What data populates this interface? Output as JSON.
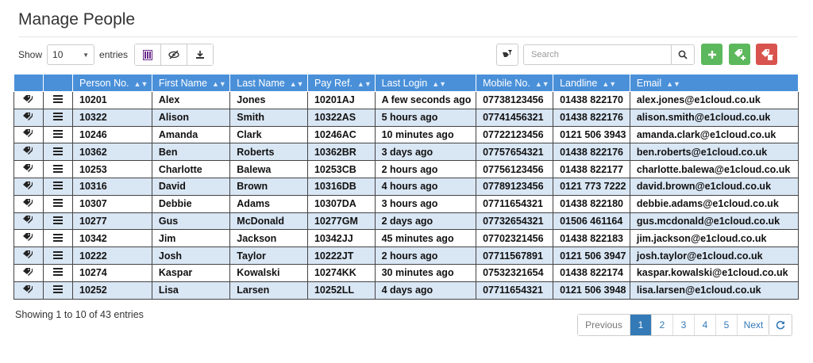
{
  "page": {
    "title": "Manage People"
  },
  "toolbar": {
    "show_label": "Show",
    "page_size": "10",
    "entries_label": "entries"
  },
  "search": {
    "placeholder": "Search"
  },
  "columns": [
    "Person No.",
    "First Name",
    "Last Name",
    "Pay Ref.",
    "Last Login",
    "Mobile No.",
    "Landline",
    "Email"
  ],
  "rows": [
    {
      "person_no": "10201",
      "first": "Alex",
      "last": "Jones",
      "pay_ref": "10201AJ",
      "last_login": "A few seconds ago",
      "mobile": "07738123456",
      "landline": "01438 822170",
      "email": "alex.jones@e1cloud.co.uk"
    },
    {
      "person_no": "10322",
      "first": "Alison",
      "last": "Smith",
      "pay_ref": "10322AS",
      "last_login": "5 hours ago",
      "mobile": "07741456321",
      "landline": "01438 822176",
      "email": "alison.smith@e1cloud.co.uk"
    },
    {
      "person_no": "10246",
      "first": "Amanda",
      "last": "Clark",
      "pay_ref": "10246AC",
      "last_login": "10 minutes ago",
      "mobile": "07722123456",
      "landline": "0121 506 3943",
      "email": "amanda.clark@e1cloud.co.uk"
    },
    {
      "person_no": "10362",
      "first": "Ben",
      "last": "Roberts",
      "pay_ref": "10362BR",
      "last_login": "3 days ago",
      "mobile": "07757654321",
      "landline": "01438 822176",
      "email": "ben.roberts@e1cloud.co.uk"
    },
    {
      "person_no": "10253",
      "first": "Charlotte",
      "last": "Balewa",
      "pay_ref": "10253CB",
      "last_login": "2 hours ago",
      "mobile": "07756123456",
      "landline": "01438 822177",
      "email": "charlotte.balewa@e1cloud.co.uk"
    },
    {
      "person_no": "10316",
      "first": "David",
      "last": "Brown",
      "pay_ref": "10316DB",
      "last_login": "4 hours ago",
      "mobile": "07789123456",
      "landline": "0121 773 7222",
      "email": "david.brown@e1cloud.co.uk"
    },
    {
      "person_no": "10307",
      "first": "Debbie",
      "last": "Adams",
      "pay_ref": "10307DA",
      "last_login": "3 hours ago",
      "mobile": "07711654321",
      "landline": "01438 822180",
      "email": "debbie.adams@e1cloud.co.uk"
    },
    {
      "person_no": "10277",
      "first": "Gus",
      "last": "McDonald",
      "pay_ref": "10277GM",
      "last_login": "2 days ago",
      "mobile": "07732654321",
      "landline": "01506 461164",
      "email": "gus.mcdonald@e1cloud.co.uk"
    },
    {
      "person_no": "10342",
      "first": "Jim",
      "last": "Jackson",
      "pay_ref": "10342JJ",
      "last_login": "45 minutes ago",
      "mobile": "07702321456",
      "landline": "01438 822183",
      "email": "jim.jackson@e1cloud.co.uk"
    },
    {
      "person_no": "10222",
      "first": "Josh",
      "last": "Taylor",
      "pay_ref": "10222JT",
      "last_login": "2 hours ago",
      "mobile": "07711567891",
      "landline": "0121 506 3947",
      "email": "josh.taylor@e1cloud.co.uk"
    },
    {
      "person_no": "10274",
      "first": "Kaspar",
      "last": "Kowalski",
      "pay_ref": "10274KK",
      "last_login": "30 minutes ago",
      "mobile": "07532321654",
      "landline": "01438 822174",
      "email": "kaspar.kowalski@e1cloud.co.uk"
    },
    {
      "person_no": "10252",
      "first": "Lisa",
      "last": "Larsen",
      "pay_ref": "10252LL",
      "last_login": "4 days ago",
      "mobile": "07711654321",
      "landline": "0121 506 3948",
      "email": "lisa.larsen@e1cloud.co.uk"
    }
  ],
  "footer": {
    "info": "Showing 1 to 10 of 43 entries"
  },
  "pagination": {
    "previous": "Previous",
    "pages": [
      "1",
      "2",
      "3",
      "4",
      "5"
    ],
    "current": "1",
    "next": "Next"
  },
  "icons": {
    "tag": "tag-icon",
    "menu": "menu-icon",
    "columns": "columns-icon",
    "hide": "eye-slash-icon",
    "download": "download-icon",
    "filter": "filter-icon",
    "search": "search-icon",
    "add": "plus-icon",
    "add_tag": "tag-plus-icon",
    "delete_tag": "tag-trash-icon",
    "refresh": "refresh-icon"
  },
  "colors": {
    "header_bg": "#4a90d9",
    "row_alt": "#d9e6f4",
    "green": "#5cb85c",
    "red": "#d9534f",
    "link": "#337ab7"
  }
}
